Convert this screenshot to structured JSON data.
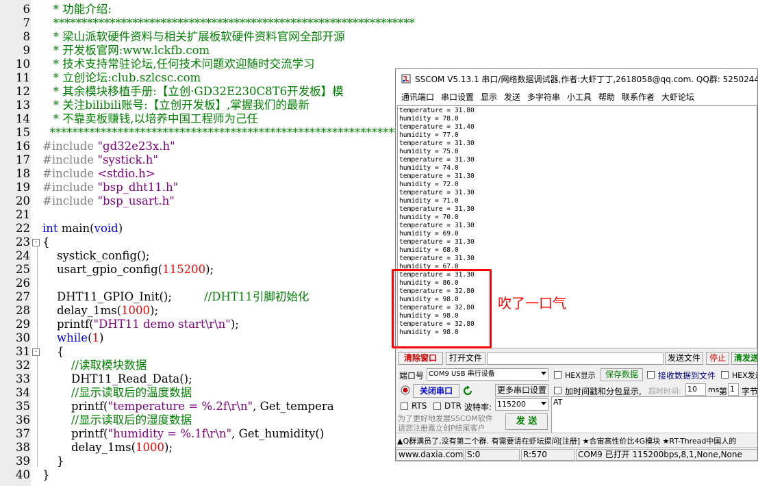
{
  "editor": {
    "lines": [
      {
        "n": "6",
        "segs": [
          {
            "c": "c-comment",
            "t": "   * 功能介绍:"
          }
        ]
      },
      {
        "n": "7",
        "segs": [
          {
            "c": "c-comment",
            "t": "   ****************************************************************"
          }
        ]
      },
      {
        "n": "8",
        "segs": [
          {
            "c": "c-comment",
            "t": "   * 梁山派软硬件资料与相关扩展板软硬件资料官网全部开源"
          }
        ]
      },
      {
        "n": "9",
        "segs": [
          {
            "c": "c-comment",
            "t": "   * 开发板官网:www.lckfb.com"
          }
        ]
      },
      {
        "n": "10",
        "segs": [
          {
            "c": "c-comment",
            "t": "   * 技术支持常驻论坛,任何技术问题欢迎随时交流学习"
          }
        ]
      },
      {
        "n": "11",
        "segs": [
          {
            "c": "c-comment",
            "t": "   * 立创论坛:club.szlcsc.com"
          }
        ]
      },
      {
        "n": "12",
        "segs": [
          {
            "c": "c-comment",
            "t": "   * 其余模块移植手册:【立创·GD32E230C8T6开发板】模"
          }
        ]
      },
      {
        "n": "13",
        "segs": [
          {
            "c": "c-comment",
            "t": "   * 关注bilibili账号:【立创开发板】,掌握我们的最新"
          }
        ]
      },
      {
        "n": "14",
        "segs": [
          {
            "c": "c-comment",
            "t": "   * 不靠卖板赚钱,以培养中国工程师为己任"
          }
        ]
      },
      {
        "n": "15",
        "segs": [
          {
            "c": "c-comment",
            "t": "  *****************************************************************"
          }
        ]
      },
      {
        "n": "16",
        "segs": [
          {
            "c": "c-pre",
            "t": "#include "
          },
          {
            "c": "c-str",
            "t": "\"gd32e23x.h\""
          }
        ]
      },
      {
        "n": "17",
        "segs": [
          {
            "c": "c-pre",
            "t": "#include "
          },
          {
            "c": "c-str",
            "t": "\"systick.h\""
          }
        ]
      },
      {
        "n": "18",
        "segs": [
          {
            "c": "c-pre",
            "t": "#include "
          },
          {
            "c": "c-str",
            "t": "<stdio.h>"
          }
        ]
      },
      {
        "n": "19",
        "segs": [
          {
            "c": "c-pre",
            "t": "#include "
          },
          {
            "c": "c-str",
            "t": "\"bsp_dht11.h\""
          }
        ]
      },
      {
        "n": "20",
        "segs": [
          {
            "c": "c-pre",
            "t": "#include "
          },
          {
            "c": "c-str",
            "t": "\"bsp_usart.h\""
          }
        ]
      },
      {
        "n": "21",
        "segs": []
      },
      {
        "n": "22",
        "segs": [
          {
            "c": "c-kw",
            "t": "int"
          },
          {
            "c": "c-plain",
            "t": " main("
          },
          {
            "c": "c-kw",
            "t": "void"
          },
          {
            "c": "c-plain",
            "t": ")"
          }
        ]
      },
      {
        "n": "23",
        "fold": "-",
        "segs": [
          {
            "c": "c-plain",
            "t": "{"
          }
        ]
      },
      {
        "n": "24",
        "segs": [
          {
            "c": "c-plain",
            "t": "    systick_config();"
          }
        ]
      },
      {
        "n": "25",
        "segs": [
          {
            "c": "c-plain",
            "t": "    usart_gpio_config("
          },
          {
            "c": "c-num",
            "t": "115200"
          },
          {
            "c": "c-plain",
            "t": ");"
          }
        ]
      },
      {
        "n": "26",
        "segs": []
      },
      {
        "n": "27",
        "segs": [
          {
            "c": "c-plain",
            "t": "    DHT11_GPIO_Init();         "
          },
          {
            "c": "c-comment",
            "t": "//DHT11引脚初始化"
          }
        ]
      },
      {
        "n": "28",
        "segs": [
          {
            "c": "c-plain",
            "t": "    delay_1ms("
          },
          {
            "c": "c-num",
            "t": "1000"
          },
          {
            "c": "c-plain",
            "t": ");"
          }
        ]
      },
      {
        "n": "29",
        "segs": [
          {
            "c": "c-plain",
            "t": "    printf("
          },
          {
            "c": "c-str",
            "t": "\"DHT11 demo start\\r\\n\""
          },
          {
            "c": "c-plain",
            "t": ");"
          }
        ]
      },
      {
        "n": "30",
        "segs": [
          {
            "c": "c-kw",
            "t": "    while"
          },
          {
            "c": "c-plain",
            "t": "("
          },
          {
            "c": "c-num",
            "t": "1"
          },
          {
            "c": "c-plain",
            "t": ")"
          }
        ]
      },
      {
        "n": "31",
        "fold": "-",
        "segs": [
          {
            "c": "c-plain",
            "t": "    {"
          }
        ]
      },
      {
        "n": "32",
        "segs": [
          {
            "c": "c-comment",
            "t": "        //读取模块数据"
          }
        ]
      },
      {
        "n": "33",
        "segs": [
          {
            "c": "c-plain",
            "t": "        DHT11_Read_Data();"
          }
        ]
      },
      {
        "n": "34",
        "segs": [
          {
            "c": "c-comment",
            "t": "        //显示读取后的温度数据"
          }
        ]
      },
      {
        "n": "35",
        "segs": [
          {
            "c": "c-plain",
            "t": "        printf("
          },
          {
            "c": "c-str",
            "t": "\"temperature = %.2f\\r\\n\""
          },
          {
            "c": "c-plain",
            "t": ", Get_tempera"
          }
        ]
      },
      {
        "n": "36",
        "segs": [
          {
            "c": "c-comment",
            "t": "        //显示读取后的湿度数据"
          }
        ]
      },
      {
        "n": "37",
        "segs": [
          {
            "c": "c-plain",
            "t": "        printf("
          },
          {
            "c": "c-str",
            "t": "\"humidity = %.1f\\r\\n\""
          },
          {
            "c": "c-plain",
            "t": ", Get_humidity()"
          }
        ]
      },
      {
        "n": "38",
        "segs": [
          {
            "c": "c-plain",
            "t": "        delay_1ms("
          },
          {
            "c": "c-num",
            "t": "1000"
          },
          {
            "c": "c-plain",
            "t": ");"
          }
        ]
      },
      {
        "n": "39",
        "segs": [
          {
            "c": "c-plain",
            "t": "    }"
          }
        ]
      },
      {
        "n": "40",
        "segs": [
          {
            "c": "c-plain",
            "t": "}"
          }
        ]
      }
    ]
  },
  "sscom": {
    "title": "SSCOM V5.13.1 串口/网络数据调试器,作者:大虾丁丁,2618058@qq.com. QQ群: 52502449",
    "menu": [
      "通讯端口",
      "串口设置",
      "显示",
      "发送",
      "多字符串",
      "小工具",
      "帮助",
      "联系作者",
      "大虾论坛"
    ],
    "receive_lines": [
      "temperature = 31.80",
      "humidity = 78.0",
      "temperature = 31.40",
      "humidity = 77.0",
      "temperature = 31.30",
      "humidity = 75.0",
      "temperature = 31.30",
      "humidity = 74.0",
      "temperature = 31.30",
      "humidity = 72.0",
      "temperature = 31.30",
      "humidity = 71.0",
      "temperature = 31.30",
      "humidity = 70.0",
      "temperature = 31.30",
      "humidity = 69.0",
      "temperature = 31.30",
      "humidity = 68.0",
      "temperature = 31.30",
      "humidity = 67.0",
      "temperature = 31.30",
      "humidity = 86.0",
      "temperature = 32.80",
      "humidity = 98.0",
      "temperature = 32.80",
      "humidity = 98.0",
      "temperature = 32.80",
      "humidity = 98.0"
    ],
    "clear_window_label": "清除窗口",
    "open_file_label": "打开文件",
    "send_file_label": "发送文件",
    "stop_label": "停止",
    "clear_send_label": "清发送",
    "port_label": "端口号",
    "port_value": "COM9 USB 串行设备",
    "hex_display_label": "HEX显示",
    "save_data_label": "保存数据",
    "recv_to_file_label": "接收数据到文件",
    "hex_send_label": "HEX发送",
    "close_port_label": "关闭串口",
    "more_settings_label": "更多串口设置",
    "timestamp_label": "加时间戳和分包显示,",
    "timeout_label": "超时时间:",
    "timeout_value": "10",
    "ms_label": "ms",
    "page_label": "第",
    "page_value": "1",
    "byte_label": "字节",
    "rts_label": "RTS",
    "dtr_label": "DTR",
    "baud_label": "波特率:",
    "baud_value": "115200",
    "send_text": "AT",
    "promo_line1": "为了更好地发展SSCOM软件",
    "promo_line2": "请您注册嘉立创P结尾客户",
    "send_label": "发 送",
    "ticker": "▲Q群满员了,没有第二个群. 有需要请在虾坛提问[注册] ★合宙高性价比4G模块 ★RT-Thread中国人的",
    "status": {
      "site": "www.daxia.com",
      "sent": "S:0",
      "received": "R:570",
      "port_status": "COM9 已打开  115200bps,8,1,None,None"
    }
  },
  "annotation": "吹了一口气",
  "colors": {
    "highlight": "#ff0000",
    "comment": "#008000",
    "keyword": "#0000ff",
    "string": "#800080",
    "number": "#ff0000"
  }
}
